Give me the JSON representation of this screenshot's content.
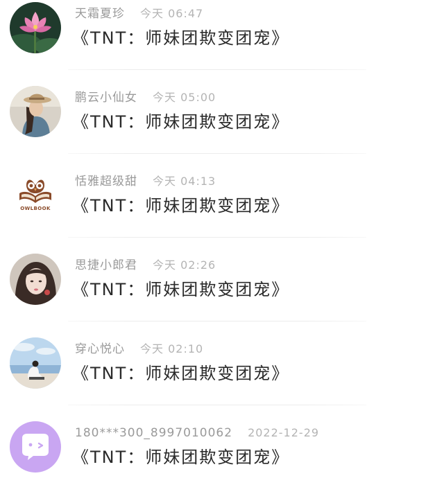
{
  "feed": {
    "items": [
      {
        "user": "天霜夏珍",
        "time": "今天 06:47",
        "title": "《TNT：师妹团欺变团宠》",
        "avatar": "lotus-avatar"
      },
      {
        "user": "鹏云小仙女",
        "time": "今天 05:00",
        "title": "《TNT：师妹团欺变团宠》",
        "avatar": "woman-hat-avatar"
      },
      {
        "user": "恬雅超级甜",
        "time": "今天 04:13",
        "title": "《TNT：师妹团欺变团宠》",
        "avatar": "owlbook-avatar",
        "avatar_text": "OWLBOOK"
      },
      {
        "user": "思捷小郎君",
        "time": "今天 02:26",
        "title": "《TNT：师妹团欺变团宠》",
        "avatar": "girl-portrait-avatar"
      },
      {
        "user": "穿心悦心",
        "time": "今天 02:10",
        "title": "《TNT：师妹团欺变团宠》",
        "avatar": "beach-avatar"
      },
      {
        "user": "180***300_8997010062",
        "time": "2022-12-29",
        "title": "《TNT：师妹团欺变团宠》",
        "avatar": "chat-bubble-avatar"
      }
    ]
  },
  "colors": {
    "username": "#9a9a9a",
    "time": "#b4b4b4",
    "title": "#2a2a2a",
    "divider": "#ececec",
    "default_avatar_bg": "#c9a6f2"
  }
}
